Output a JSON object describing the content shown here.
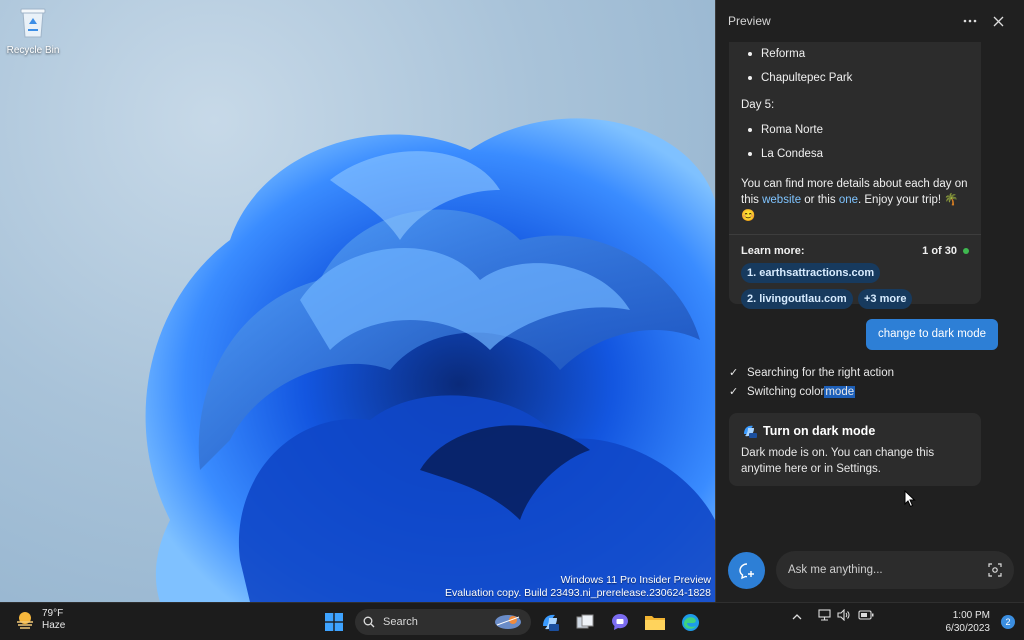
{
  "desktop": {
    "recycle_bin_label": "Recycle Bin",
    "watermark_line1": "Windows 11 Pro Insider Preview",
    "watermark_line2": "Evaluation copy. Build 23493.ni_prerelease.230624-1828"
  },
  "pane": {
    "title": "Preview",
    "answer": {
      "bullets_day4": [
        "Reforma",
        "Chapultepec Park"
      ],
      "day5_label": "Day 5:",
      "bullets_day5": [
        "Roma Norte",
        "La Condesa"
      ],
      "para_1": "You can find more details about each day on this ",
      "link_website": "website",
      "para_2": " or this ",
      "link_one": "one",
      "para_3": ". Enjoy your trip! 🌴",
      "para_4": "😊",
      "learn_more_label": "Learn more:",
      "counter": "1 of 30",
      "sources": [
        "1. earthsattractions.com",
        "2. livingoutlau.com",
        "+3 more"
      ]
    },
    "user_message": "change to dark mode",
    "progress": {
      "step1": "Searching for the right action",
      "step2_prefix": "Switching color ",
      "step2_highlight": "mode"
    },
    "action_card": {
      "title": "Turn on dark mode",
      "text": "Dark mode is on. You can change this anytime here or in Settings."
    },
    "input_placeholder": "Ask me anything..."
  },
  "taskbar": {
    "weather_temp": "79°F",
    "weather_desc": "Haze",
    "search_label": "Search",
    "time": "1:00 PM",
    "date": "6/30/2023",
    "notification_count": "2"
  },
  "colors": {
    "accent": "#2d7fd6",
    "pane_bg": "#202020",
    "card_bg": "#2c2c2c",
    "link": "#7fc4ff"
  }
}
